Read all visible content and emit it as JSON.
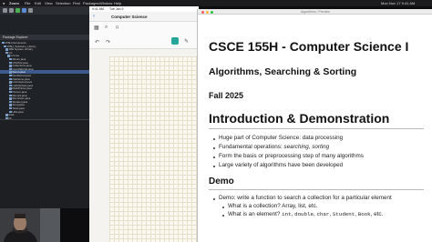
{
  "menubar": {
    "apple": "",
    "app": "Zoom",
    "items": [
      "File",
      "Edit",
      "View",
      "Selection",
      "Find",
      "Packages",
      "Window",
      "Help"
    ],
    "datetime": "Mon Nov 17 9:41 AM"
  },
  "eclipse": {
    "panel_title": "Package Explorer",
    "tree": [
      {
        "label": "155H Documents"
      },
      {
        "label": "155H_Solutions_Library"
      },
      {
        "label": "JRE System Library"
      },
      {
        "label": "src"
      },
      {
        "label": "unl.cse"
      },
      {
        "label": "Album.java"
      },
      {
        "label": "CSVFile.java"
      },
      {
        "label": "Collections.java"
      },
      {
        "label": "CountWords.java"
      },
      {
        "label": "Demo.java",
        "selected": true
      },
      {
        "label": "DoubleList.java"
      },
      {
        "label": "FileDemo.java"
      },
      {
        "label": "IntArrayList.java"
      },
      {
        "label": "ListInterface.java"
      },
      {
        "label": "MultiPrinter.java"
      },
      {
        "label": "Person.java"
      },
      {
        "label": "Record.java"
      },
      {
        "label": "Recursion.java"
      },
      {
        "label": "Student.java"
      },
      {
        "label": "Song.java"
      },
      {
        "label": "Tests.java"
      },
      {
        "label": "Utils.java"
      },
      {
        "label": "data"
      },
      {
        "label": "lib"
      }
    ]
  },
  "ipad": {
    "status_time": "9:41 AM",
    "status_date": "Tue Jan 9",
    "doc_title": "Computer Science"
  },
  "preview": {
    "window_title": "Algorithms / Preview",
    "title": "CSCE 155H - Computer Science I",
    "subtitle": "Algorithms, Searching & Sorting",
    "term": "Fall 2025",
    "section1": "Introduction & Demonstration",
    "bullets1": [
      "Huge part of Computer Science: data processing",
      "Fundamental operations: searching, sorting",
      "Form the basis or preprocessing step of many algorithms",
      "Large variety of algorithms have been developed"
    ],
    "section2": "Demo",
    "bullets2": [
      "Demo: write a function to search a collection for a particular element"
    ],
    "sub_bullets": [
      "What is a collection? Array, list, etc.",
      "What is an element?"
    ],
    "element_types": [
      "int",
      "double",
      "char",
      "Student",
      "Book",
      "etc."
    ]
  },
  "colors": {
    "eclipse_bg": "#1f2226",
    "preview_bg": "#ffffff",
    "ipad_grid": "#fbf8ef",
    "accent_teal": "#26a69a"
  }
}
